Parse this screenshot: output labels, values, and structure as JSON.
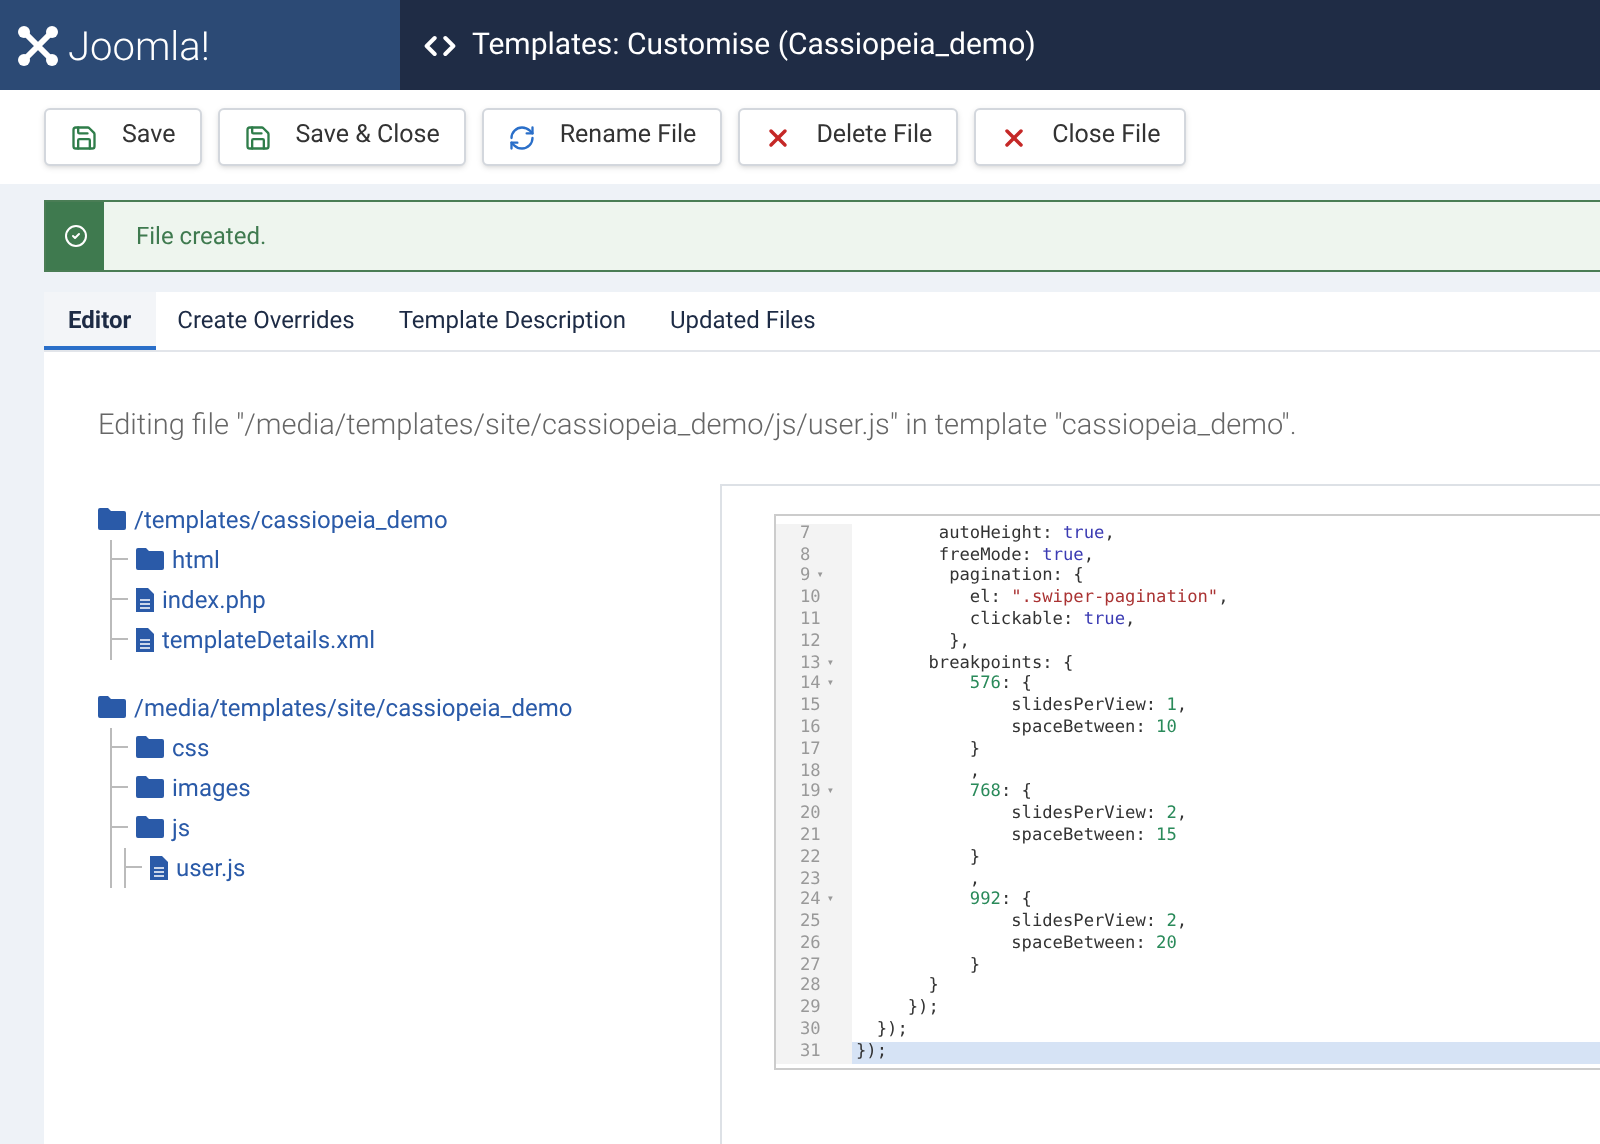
{
  "header": {
    "logo": "Joomla!",
    "title": "Templates: Customise (Cassiopeia_demo)"
  },
  "toolbar": [
    {
      "label": "Save",
      "kind": "save"
    },
    {
      "label": "Save & Close",
      "kind": "save"
    },
    {
      "label": "Rename File",
      "kind": "refresh"
    },
    {
      "label": "Delete File",
      "kind": "close"
    },
    {
      "label": "Close File",
      "kind": "close"
    }
  ],
  "alert": {
    "message": "File created."
  },
  "tabs": [
    {
      "label": "Editor",
      "selected": true
    },
    {
      "label": "Create Overrides",
      "selected": false
    },
    {
      "label": "Template Description",
      "selected": false
    },
    {
      "label": "Updated Files",
      "selected": false
    }
  ],
  "editing_text": "Editing file \"/media/templates/site/cassiopeia_demo/js/user.js\" in template \"cassiopeia_demo\".",
  "tree": [
    {
      "kind": "folder",
      "label": "/templates/cassiopeia_demo",
      "children": [
        {
          "kind": "folder",
          "label": "html"
        },
        {
          "kind": "file",
          "label": "index.php"
        },
        {
          "kind": "file",
          "label": "templateDetails.xml"
        }
      ]
    },
    {
      "kind": "folder",
      "label": "/media/templates/site/cassiopeia_demo",
      "children": [
        {
          "kind": "folder",
          "label": "css"
        },
        {
          "kind": "folder",
          "label": "images"
        },
        {
          "kind": "folder",
          "label": "js",
          "children": [
            {
              "kind": "file",
              "label": "user.js"
            }
          ]
        }
      ]
    }
  ],
  "code_lines": [
    {
      "number": "7",
      "active": false,
      "tokens": [
        {
          "kind": "plain",
          "text": "        autoHeight: "
        },
        {
          "kind": "keyword",
          "text": "true"
        },
        {
          "kind": "plain",
          "text": ","
        }
      ]
    },
    {
      "number": "8",
      "active": false,
      "tokens": [
        {
          "kind": "plain",
          "text": "        freeMode: "
        },
        {
          "kind": "keyword",
          "text": "true"
        },
        {
          "kind": "plain",
          "text": ","
        }
      ]
    },
    {
      "number": "9",
      "fold": "▾",
      "active": false,
      "tokens": [
        {
          "kind": "plain",
          "text": "         pagination: {"
        }
      ]
    },
    {
      "number": "10",
      "active": false,
      "tokens": [
        {
          "kind": "plain",
          "text": "           el: "
        },
        {
          "kind": "string",
          "text": "\".swiper-pagination\""
        },
        {
          "kind": "plain",
          "text": ","
        }
      ]
    },
    {
      "number": "11",
      "active": false,
      "tokens": [
        {
          "kind": "plain",
          "text": "           clickable: "
        },
        {
          "kind": "keyword",
          "text": "true"
        },
        {
          "kind": "plain",
          "text": ","
        }
      ]
    },
    {
      "number": "12",
      "active": false,
      "tokens": [
        {
          "kind": "plain",
          "text": "         },"
        }
      ]
    },
    {
      "number": "13",
      "fold": "▾",
      "active": false,
      "tokens": [
        {
          "kind": "plain",
          "text": "       breakpoints: {"
        }
      ]
    },
    {
      "number": "14",
      "fold": "▾",
      "active": false,
      "tokens": [
        {
          "kind": "number",
          "text": "           576"
        },
        {
          "kind": "plain",
          "text": ": {"
        }
      ]
    },
    {
      "number": "15",
      "active": false,
      "tokens": [
        {
          "kind": "plain",
          "text": "               slidesPerView: "
        },
        {
          "kind": "number",
          "text": "1"
        },
        {
          "kind": "plain",
          "text": ","
        }
      ]
    },
    {
      "number": "16",
      "active": false,
      "tokens": [
        {
          "kind": "plain",
          "text": "               spaceBetween: "
        },
        {
          "kind": "number",
          "text": "10"
        }
      ]
    },
    {
      "number": "17",
      "active": false,
      "tokens": [
        {
          "kind": "plain",
          "text": "           }"
        }
      ]
    },
    {
      "number": "18",
      "active": false,
      "tokens": [
        {
          "kind": "plain",
          "text": "           ,"
        }
      ]
    },
    {
      "number": "19",
      "fold": "▾",
      "active": false,
      "tokens": [
        {
          "kind": "number",
          "text": "           768"
        },
        {
          "kind": "plain",
          "text": ": {"
        }
      ]
    },
    {
      "number": "20",
      "active": false,
      "tokens": [
        {
          "kind": "plain",
          "text": "               slidesPerView: "
        },
        {
          "kind": "number",
          "text": "2"
        },
        {
          "kind": "plain",
          "text": ","
        }
      ]
    },
    {
      "number": "21",
      "active": false,
      "tokens": [
        {
          "kind": "plain",
          "text": "               spaceBetween: "
        },
        {
          "kind": "number",
          "text": "15"
        }
      ]
    },
    {
      "number": "22",
      "active": false,
      "tokens": [
        {
          "kind": "plain",
          "text": "           }"
        }
      ]
    },
    {
      "number": "23",
      "active": false,
      "tokens": [
        {
          "kind": "plain",
          "text": "           ,"
        }
      ]
    },
    {
      "number": "24",
      "fold": "▾",
      "active": false,
      "tokens": [
        {
          "kind": "number",
          "text": "           992"
        },
        {
          "kind": "plain",
          "text": ": {"
        }
      ]
    },
    {
      "number": "25",
      "active": false,
      "tokens": [
        {
          "kind": "plain",
          "text": "               slidesPerView: "
        },
        {
          "kind": "number",
          "text": "2"
        },
        {
          "kind": "plain",
          "text": ","
        }
      ]
    },
    {
      "number": "26",
      "active": false,
      "tokens": [
        {
          "kind": "plain",
          "text": "               spaceBetween: "
        },
        {
          "kind": "number",
          "text": "20"
        }
      ]
    },
    {
      "number": "27",
      "active": false,
      "tokens": [
        {
          "kind": "plain",
          "text": "           }"
        }
      ]
    },
    {
      "number": "28",
      "active": false,
      "tokens": [
        {
          "kind": "plain",
          "text": "       }"
        }
      ]
    },
    {
      "number": "29",
      "active": false,
      "tokens": [
        {
          "kind": "plain",
          "text": "     });"
        }
      ]
    },
    {
      "number": "30",
      "active": false,
      "tokens": [
        {
          "kind": "plain",
          "text": "  });"
        }
      ]
    },
    {
      "number": "31",
      "active": true,
      "tokens": [
        {
          "kind": "plain",
          "text": "});"
        }
      ]
    }
  ]
}
